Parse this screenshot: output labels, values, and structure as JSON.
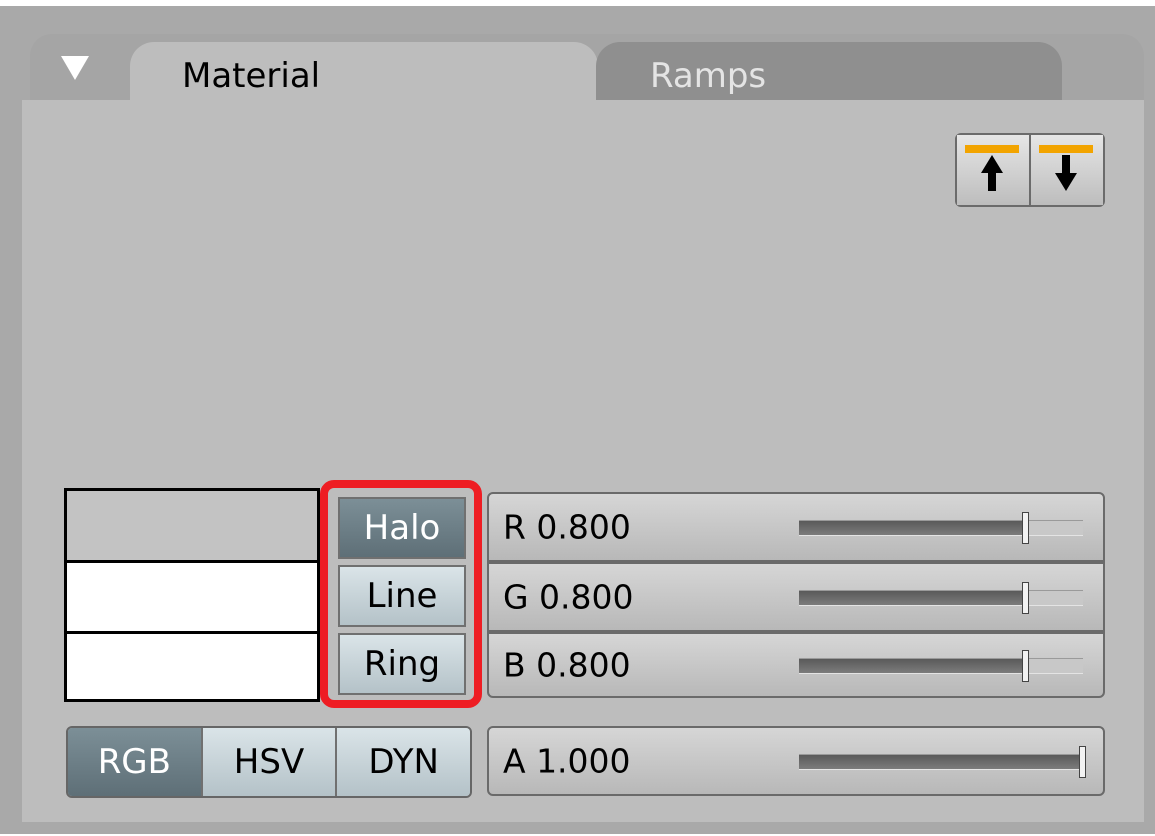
{
  "panel": {
    "collapse_icon": "triangle-down-icon",
    "tabs": [
      {
        "label": "Material",
        "active": true
      },
      {
        "label": "Ramps",
        "active": false
      }
    ],
    "move_buttons": {
      "up_icon": "move-up-arrow-icon",
      "down_icon": "move-down-arrow-icon",
      "accent_color": "#f2a400"
    }
  },
  "preview": {
    "swatch_colors": [
      "#c3c3c3",
      "#ffffff",
      "#ffffff"
    ]
  },
  "mode_buttons": {
    "halo": {
      "label": "Halo",
      "active": true
    },
    "line": {
      "label": "Line",
      "active": false
    },
    "ring": {
      "label": "Ring",
      "active": false
    },
    "highlight_color": "#ee1d23"
  },
  "sliders": {
    "r": {
      "label": "R 0.800",
      "value": 0.8
    },
    "g": {
      "label": "G 0.800",
      "value": 0.8
    },
    "b": {
      "label": "B 0.800",
      "value": 0.8
    },
    "a": {
      "label": "A 1.000",
      "value": 1.0
    }
  },
  "color_modes": {
    "rgb": {
      "label": "RGB",
      "active": true
    },
    "hsv": {
      "label": "HSV",
      "active": false
    },
    "dyn": {
      "label": "DYN",
      "active": false
    }
  }
}
